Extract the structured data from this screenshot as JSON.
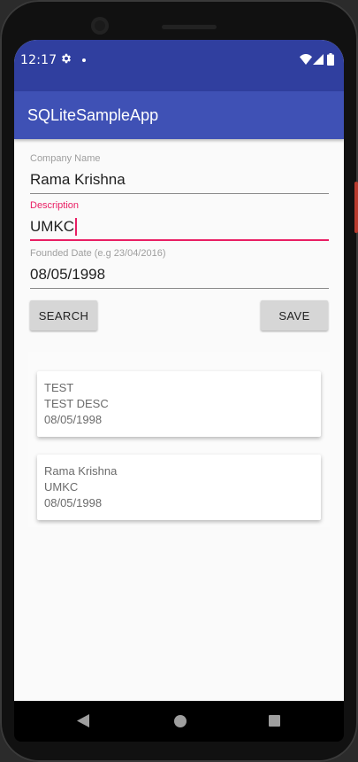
{
  "status_bar": {
    "time": "12:17"
  },
  "app_bar": {
    "title": "SQLiteSampleApp"
  },
  "form": {
    "company_name": {
      "label": "Company Name",
      "value": "Rama Krishna"
    },
    "description": {
      "label": "Description",
      "value": "UMKC"
    },
    "founded_date": {
      "label": "Founded Date (e.g 23/04/2016)",
      "value": "08/05/1998"
    },
    "search_label": "SEARCH",
    "save_label": "SAVE"
  },
  "records": [
    {
      "name": "TEST",
      "description": "TEST DESC",
      "date": "08/05/1998"
    },
    {
      "name": "Rama Krishna",
      "description": "UMKC",
      "date": "08/05/1998"
    }
  ],
  "colors": {
    "primary": "#3f51b5",
    "primary_dark": "#303f9f",
    "accent": "#e91e63"
  },
  "icons": [
    "settings-icon",
    "notification-dot-icon",
    "wifi-icon",
    "signal-icon",
    "battery-icon",
    "back-icon",
    "home-icon",
    "recents-icon"
  ]
}
